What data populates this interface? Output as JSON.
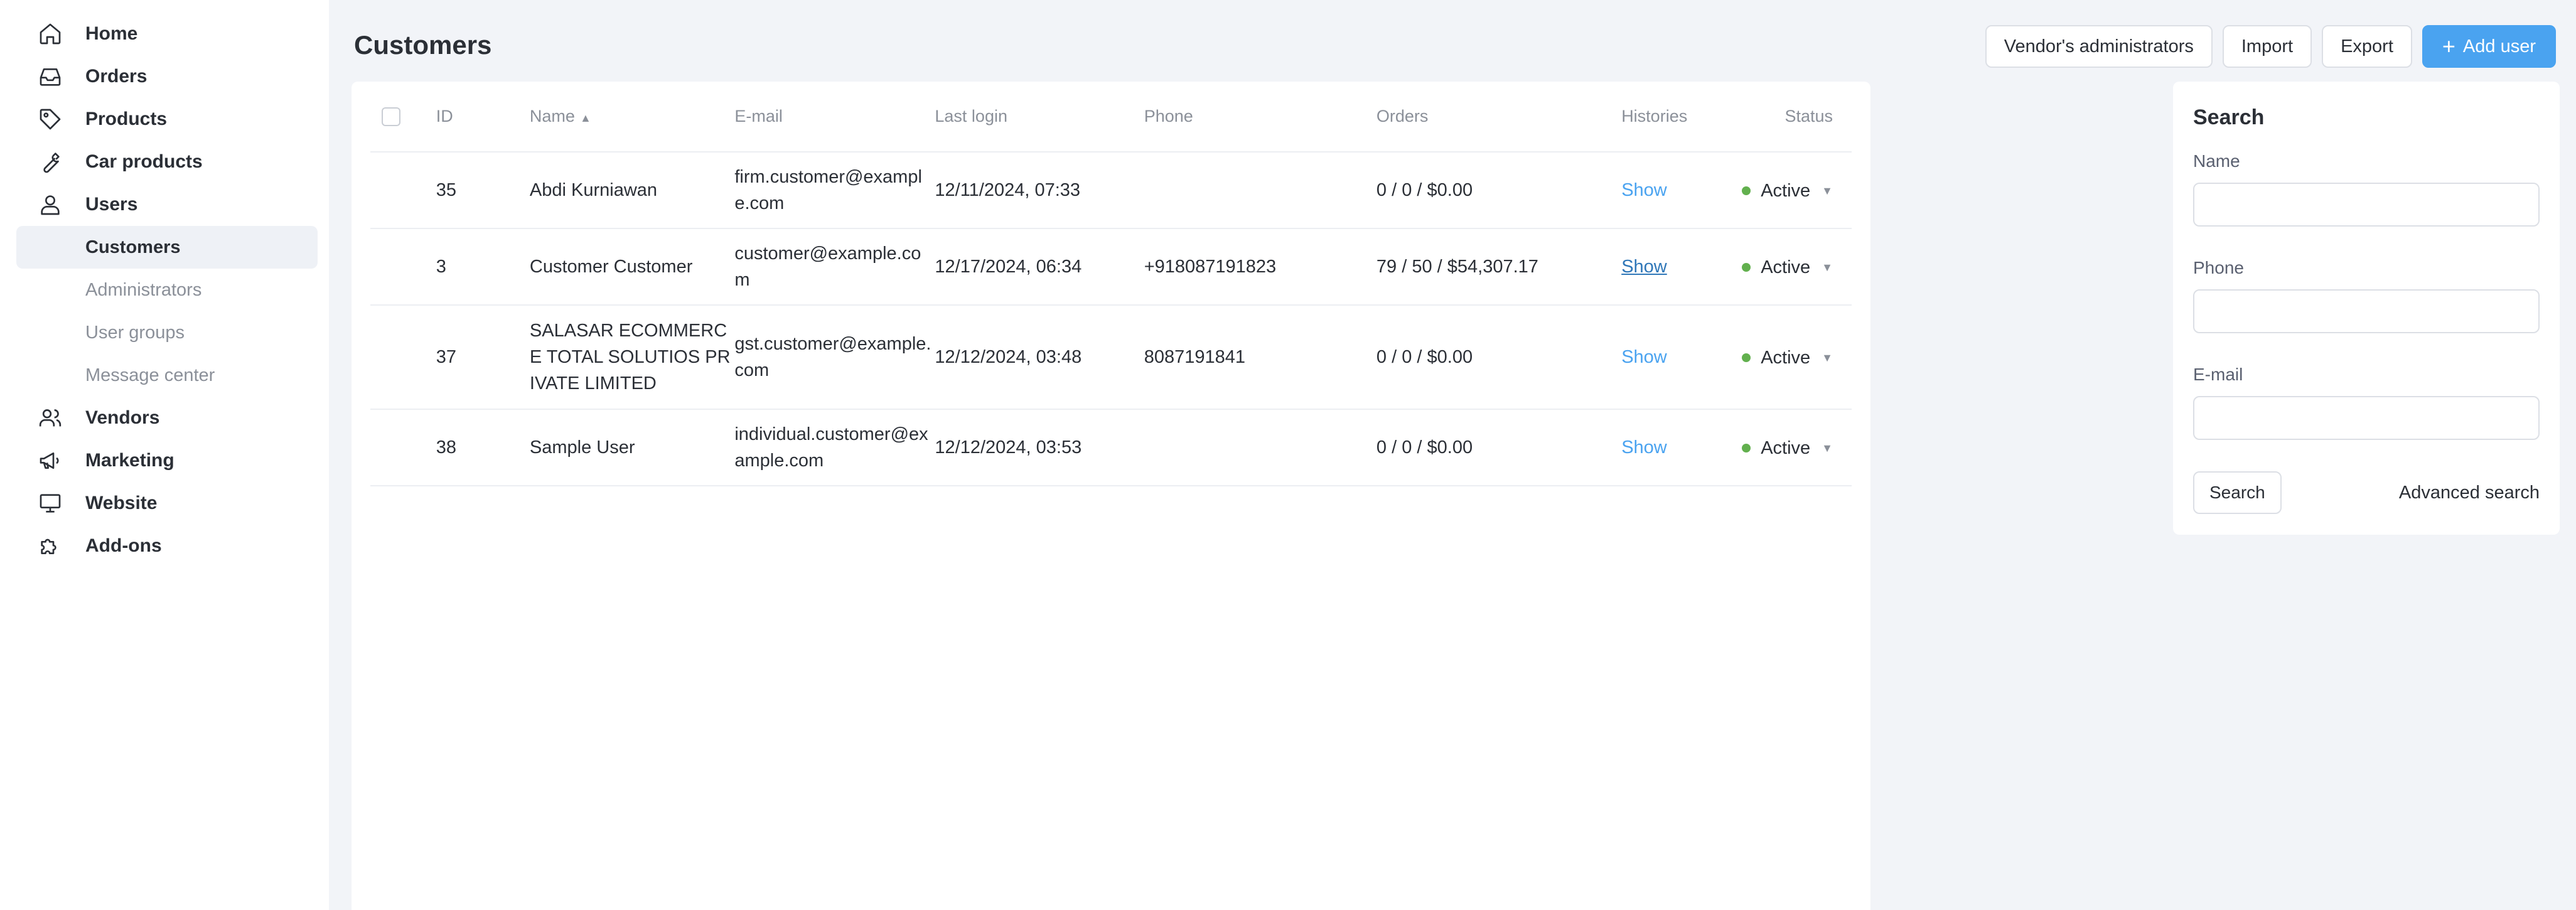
{
  "sidebar": {
    "items": [
      {
        "label": "Home",
        "icon": "home-icon"
      },
      {
        "label": "Orders",
        "icon": "inbox-icon"
      },
      {
        "label": "Products",
        "icon": "tag-icon"
      },
      {
        "label": "Car products",
        "icon": "wrench-icon"
      },
      {
        "label": "Users",
        "icon": "user-icon"
      }
    ],
    "sub_items": [
      {
        "label": "Customers",
        "active": true
      },
      {
        "label": "Administrators"
      },
      {
        "label": "User groups"
      },
      {
        "label": "Message center"
      }
    ],
    "items_after": [
      {
        "label": "Vendors",
        "icon": "users-icon"
      },
      {
        "label": "Marketing",
        "icon": "megaphone-icon"
      },
      {
        "label": "Website",
        "icon": "monitor-icon"
      },
      {
        "label": "Add-ons",
        "icon": "puzzle-icon"
      }
    ]
  },
  "header": {
    "title": "Customers",
    "buttons": {
      "vendors_admins": "Vendor's administrators",
      "import": "Import",
      "export": "Export",
      "add_user": "Add user"
    }
  },
  "table": {
    "columns": {
      "id": "ID",
      "name": "Name",
      "email": "E-mail",
      "last_login": "Last login",
      "phone": "Phone",
      "orders": "Orders",
      "histories": "Histories",
      "status": "Status"
    },
    "rows": [
      {
        "id": "35",
        "name": "Abdi Kurniawan",
        "email": "firm.customer@example.com",
        "last_login": "12/11/2024, 07:33",
        "phone": "",
        "orders": "0 / 0 / $0.00",
        "histories": "Show",
        "status": "Active"
      },
      {
        "id": "3",
        "name": "Customer Customer",
        "email": "customer@example.com",
        "last_login": "12/17/2024, 06:34",
        "phone": "+918087191823",
        "orders": "79 / 50 / $54,307.17",
        "histories": "Show",
        "status": "Active"
      },
      {
        "id": "37",
        "name": "SALASAR ECOMMERCE TOTAL SOLUTIOS PRIVATE LIMITED",
        "email": "gst.customer@example.com",
        "last_login": "12/12/2024, 03:48",
        "phone": "8087191841",
        "orders": "0 / 0 / $0.00",
        "histories": "Show",
        "status": "Active"
      },
      {
        "id": "38",
        "name": "Sample User",
        "email": "individual.customer@example.com",
        "last_login": "12/12/2024, 03:53",
        "phone": "",
        "orders": "0 / 0 / $0.00",
        "histories": "Show",
        "status": "Active"
      }
    ]
  },
  "search": {
    "title": "Search",
    "name_label": "Name",
    "phone_label": "Phone",
    "email_label": "E-mail",
    "search_button": "Search",
    "advanced_link": "Advanced search"
  },
  "colors": {
    "accent": "#4aa3f0",
    "status_active": "#62b04e",
    "main_bg": "#f2f4f8"
  }
}
